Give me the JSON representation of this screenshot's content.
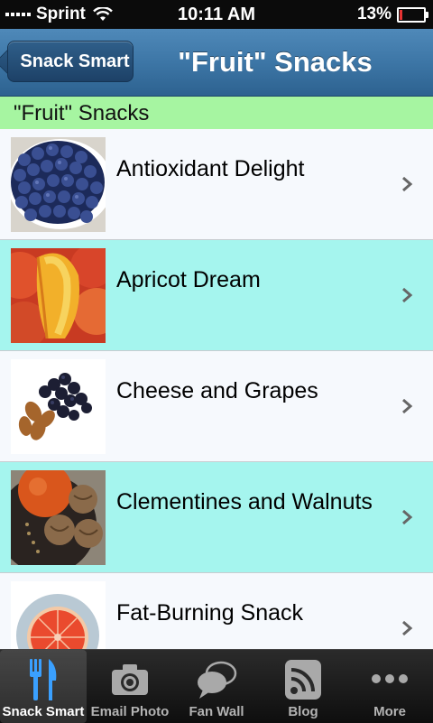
{
  "status": {
    "carrier": "Sprint",
    "time": "10:11 AM",
    "battery": "13%",
    "battery_level": 0.13
  },
  "nav": {
    "back_label": "Snack Smart",
    "title": "\"Fruit\" Snacks"
  },
  "section": {
    "title": "\"Fruit\" Snacks"
  },
  "items": [
    {
      "label": "Antioxidant Delight"
    },
    {
      "label": "Apricot Dream"
    },
    {
      "label": "Cheese and Grapes"
    },
    {
      "label": "Clementines and Walnuts"
    },
    {
      "label": "Fat-Burning Snack"
    }
  ],
  "tabs": [
    {
      "label": "Snack Smart",
      "icon": "fork-knife-icon"
    },
    {
      "label": "Email Photo",
      "icon": "camera-icon"
    },
    {
      "label": "Fan Wall",
      "icon": "speech-bubbles-icon"
    },
    {
      "label": "Blog",
      "icon": "rss-icon"
    },
    {
      "label": "More",
      "icon": "more-dots-icon"
    }
  ],
  "colors": {
    "accent": "#3d76a6",
    "section": "#a6f5a1",
    "row_alt": "#a5f5ee",
    "active_tab_icon": "#3aa0ff"
  }
}
